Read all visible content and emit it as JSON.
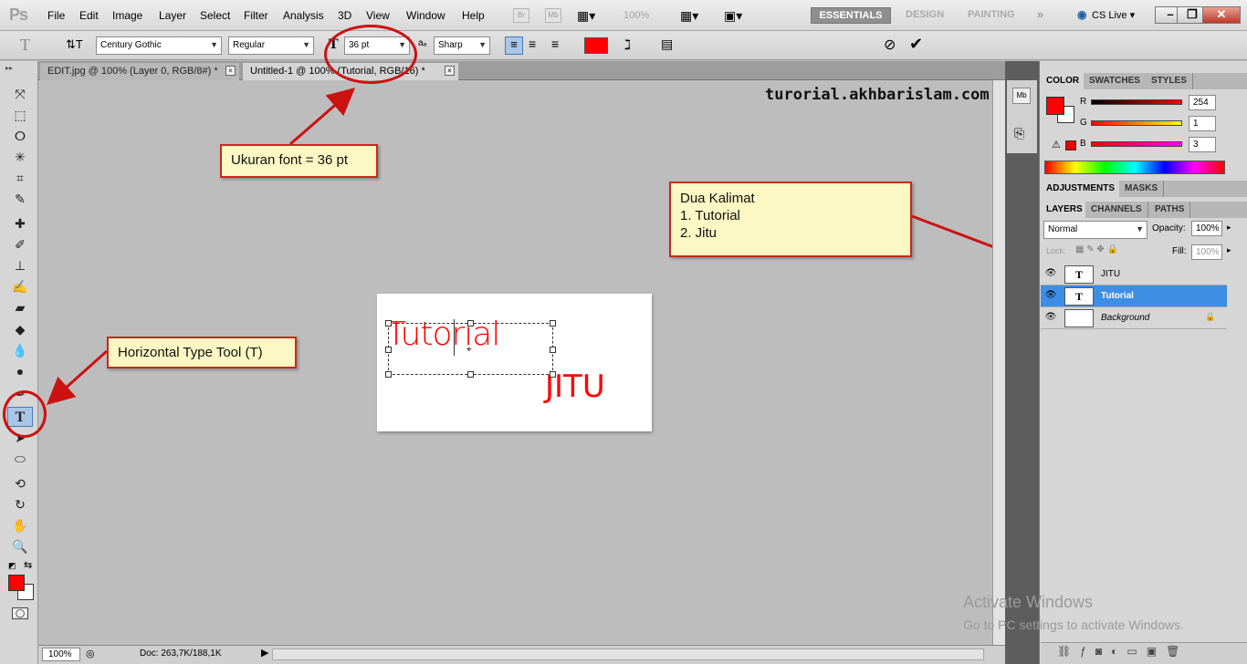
{
  "app": {
    "logo": "Ps"
  },
  "menu": [
    "File",
    "Edit",
    "Image",
    "Layer",
    "Select",
    "Filter",
    "Analysis",
    "3D",
    "View",
    "Window",
    "Help"
  ],
  "appbar": {
    "zoom": "100%",
    "bridge": "Br",
    "mini_bridge": "Mb"
  },
  "workspaces": [
    "ESSENTIALS",
    "DESIGN",
    "PAINTING"
  ],
  "cs_live": "CS Live",
  "options": {
    "tool_glyph": "T",
    "font_family": "Century Gothic",
    "font_style": "Regular",
    "font_size": "36 pt",
    "antialias": "Sharp",
    "text_color": "#ff0000"
  },
  "tabs": [
    {
      "label": "EDIT.jpg @ 100% (Layer 0, RGB/8#) *",
      "close": "×"
    },
    {
      "label": "Untitled-1 @ 100% (Tutorial, RGB/16) *",
      "close": "×"
    }
  ],
  "canvas": {
    "text_main": "Tutorial",
    "text_second": "JITU"
  },
  "watermark": "turorial.akhbarislam.com",
  "callouts": {
    "font_size": "Ukuran font = 36 pt",
    "type_tool": "Horizontal Type Tool (T)",
    "dua_title": "Dua Kalimat",
    "dua_line1": "1. Tutorial",
    "dua_line2": "2. Jitu"
  },
  "color_panel": {
    "tabs": [
      "COLOR",
      "SWATCHES",
      "STYLES"
    ],
    "r_label": "R",
    "r_value": "254",
    "g_label": "G",
    "g_value": "1",
    "b_label": "B",
    "b_value": "3",
    "fg": "#fe0103"
  },
  "adjust_panel": {
    "tabs": [
      "ADJUSTMENTS",
      "MASKS"
    ]
  },
  "layers_panel": {
    "tabs": [
      "LAYERS",
      "CHANNELS",
      "PATHS"
    ],
    "blend_mode": "Normal",
    "opacity_label": "Opacity:",
    "opacity_value": "100%",
    "lock_label": "Lock:",
    "fill_label": "Fill:",
    "fill_value": "100%",
    "layers": [
      {
        "name": "JITU",
        "type_glyph": "T",
        "selected": false
      },
      {
        "name": "Tutorial",
        "type_glyph": "T",
        "selected": true
      },
      {
        "name": "Background",
        "type_glyph": "",
        "selected": false
      }
    ]
  },
  "status": {
    "zoom": "100%",
    "doc": "Doc: 263,7K/188,1K"
  },
  "activate": {
    "title": "Activate Windows",
    "subtitle": "Go to PC settings to activate Windows."
  }
}
